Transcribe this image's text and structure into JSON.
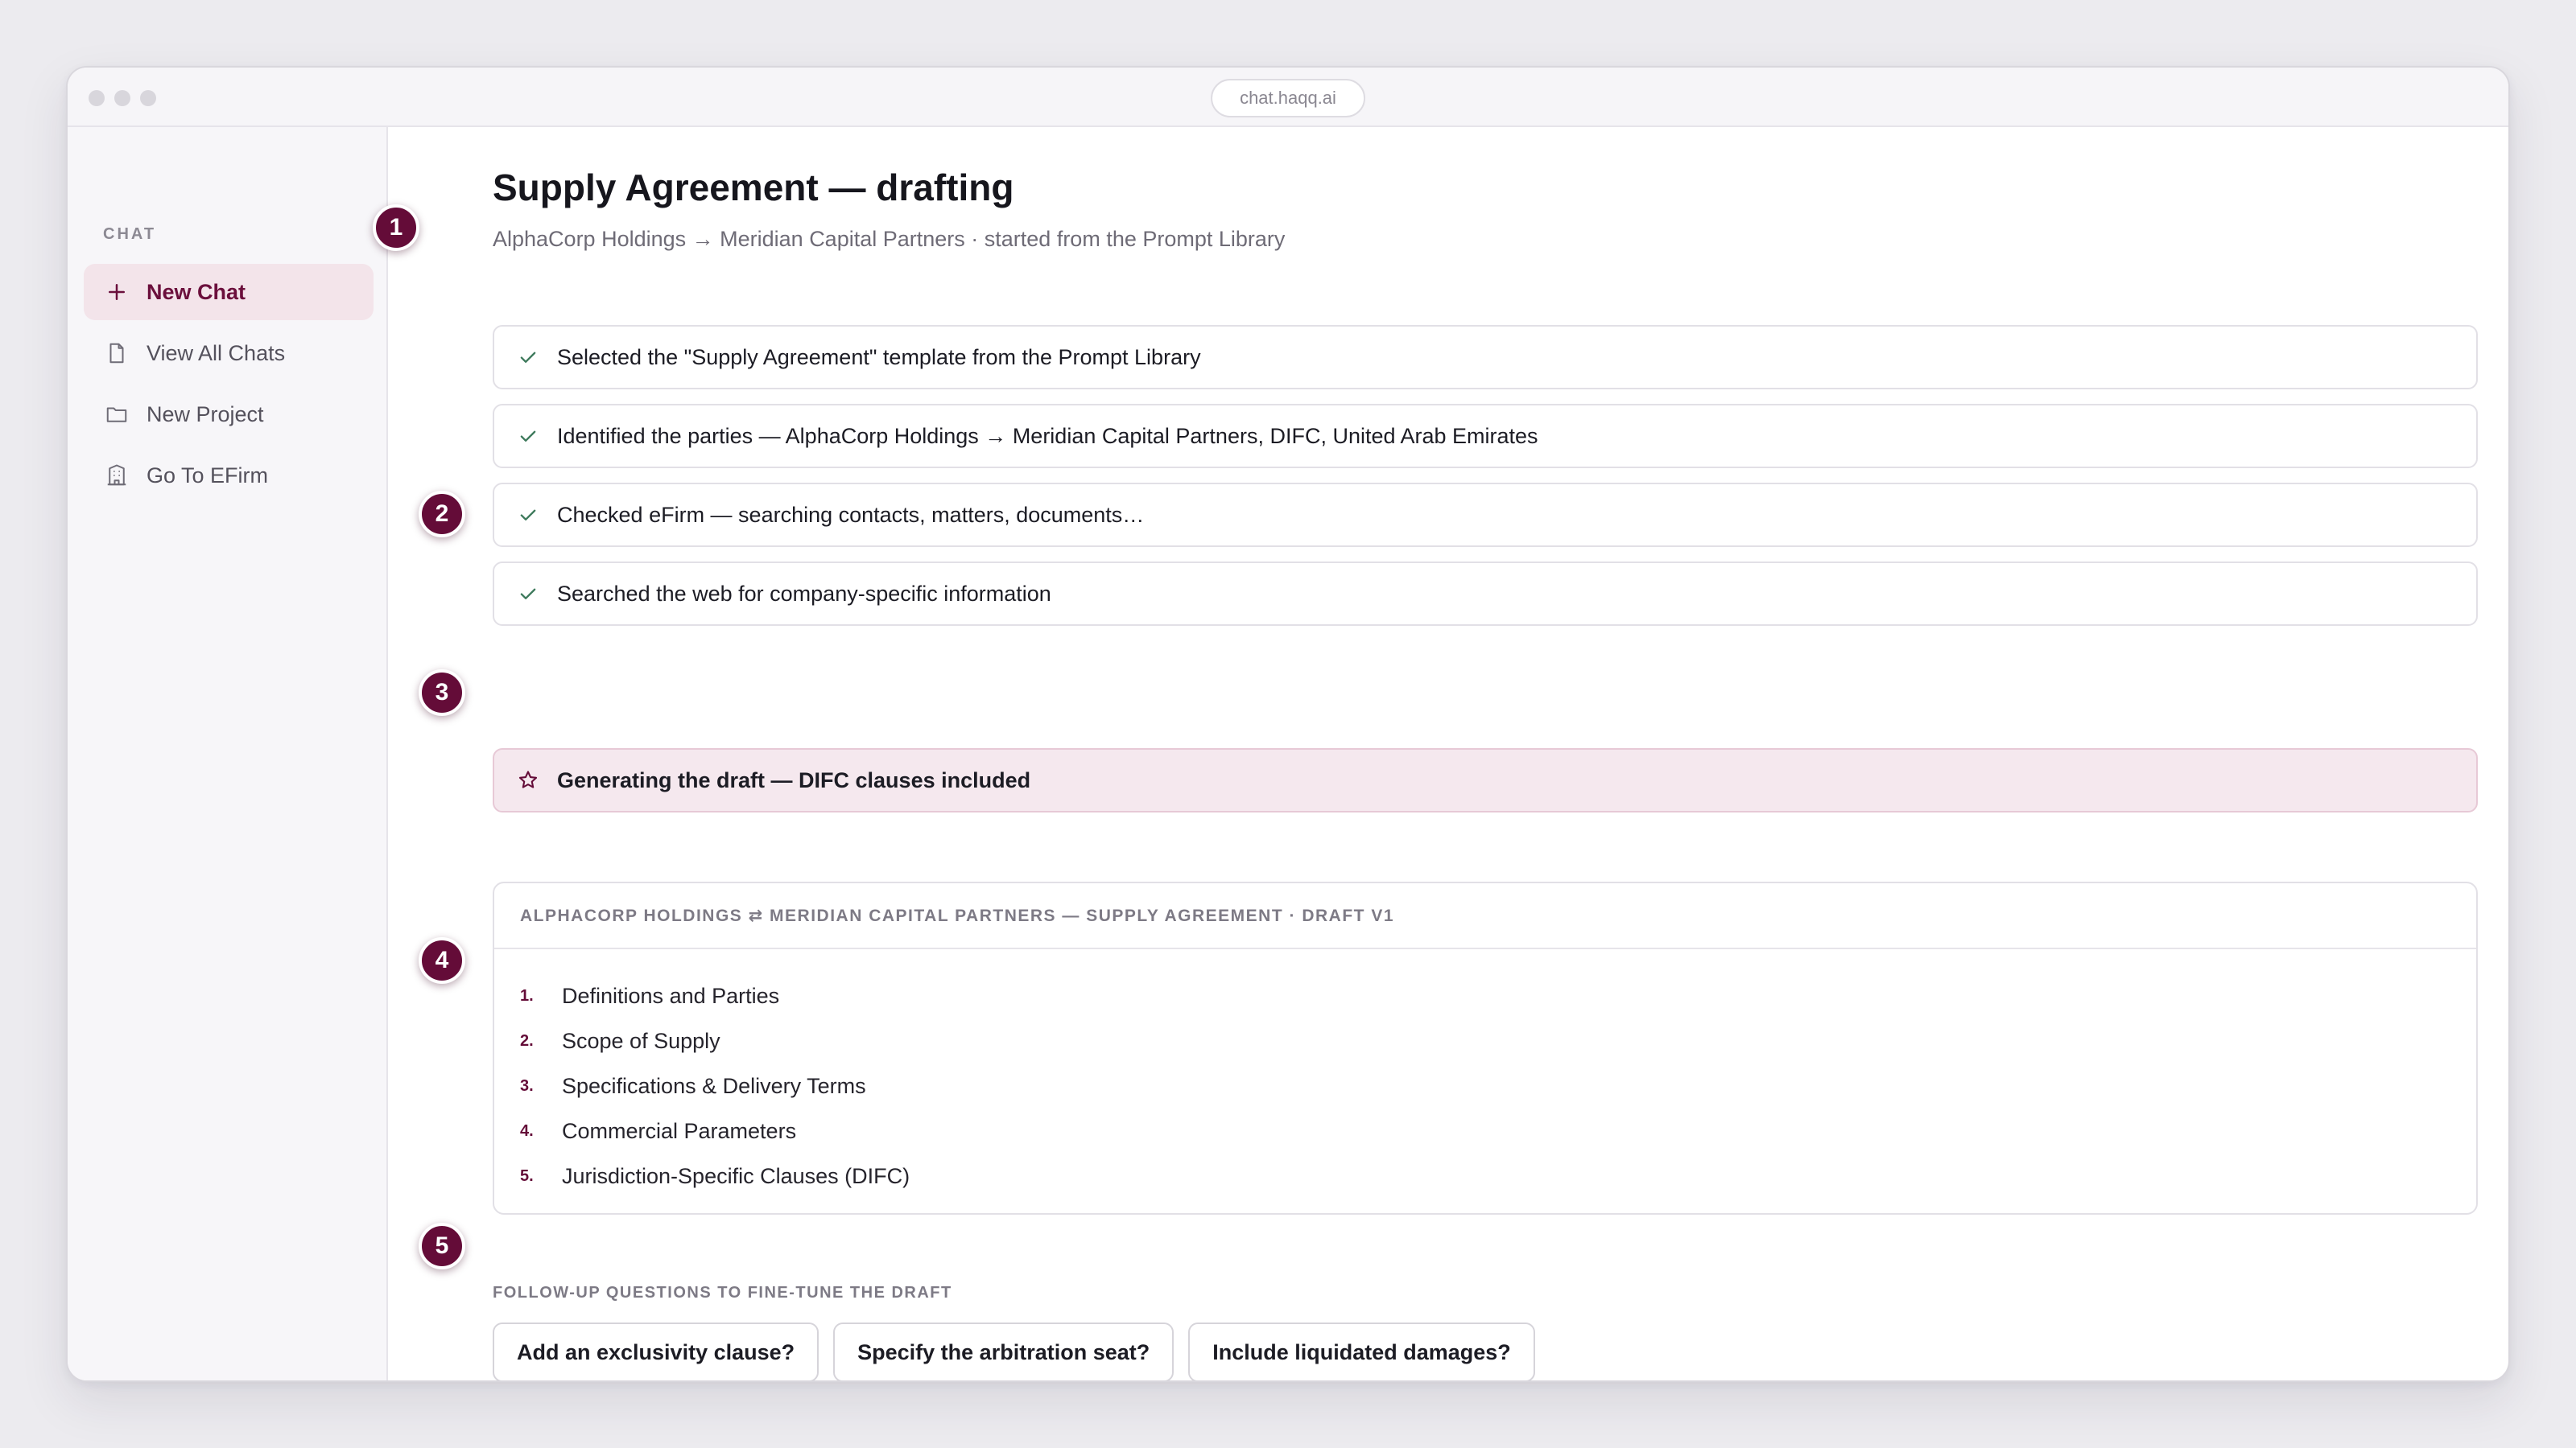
{
  "browser": {
    "url": "chat.haqq.ai"
  },
  "sidebar": {
    "section_label": "CHAT",
    "items": [
      {
        "label": "New Chat",
        "icon": "plus-icon"
      },
      {
        "label": "View All Chats",
        "icon": "document-icon"
      },
      {
        "label": "New Project",
        "icon": "folder-icon"
      },
      {
        "label": "Go To EFirm",
        "icon": "building-icon"
      }
    ]
  },
  "main": {
    "title": "Supply Agreement — drafting",
    "subtitle": "AlphaCorp Holdings → Meridian Capital Partners · started from the Prompt Library",
    "steps": [
      {
        "label": "Selected the \"Supply Agreement\" template from the Prompt Library",
        "status": "done"
      },
      {
        "label": "Identified the parties — AlphaCorp Holdings → Meridian Capital Partners, DIFC, United Arab Emirates",
        "status": "done"
      },
      {
        "label": "Checked eFirm — searching contacts, matters, documents…",
        "status": "done"
      },
      {
        "label": "Searched the web for company-specific information",
        "status": "done"
      },
      {
        "label": "Generating the draft — DIFC clauses included",
        "status": "in-progress"
      }
    ],
    "draft": {
      "header": "ALPHACORP HOLDINGS ⇄ MERIDIAN CAPITAL PARTNERS — SUPPLY AGREEMENT · DRAFT V1",
      "sections": [
        {
          "num": "1.",
          "title": "Definitions and Parties"
        },
        {
          "num": "2.",
          "title": "Scope of Supply"
        },
        {
          "num": "3.",
          "title": "Specifications & Delivery Terms"
        },
        {
          "num": "4.",
          "title": "Commercial Parameters"
        },
        {
          "num": "5.",
          "title": "Jurisdiction-Specific Clauses (DIFC)"
        }
      ]
    },
    "followup": {
      "label": "FOLLOW-UP QUESTIONS TO FINE-TUNE THE DRAFT",
      "chips": [
        "Add an exclusivity clause?",
        "Specify the arbitration seat?",
        "Include liquidated damages?"
      ]
    }
  },
  "callouts": [
    "1",
    "2",
    "3",
    "4",
    "5"
  ],
  "colors": {
    "accent": "#640c38",
    "accent_bg": "#f3e4ea",
    "check": "#3e7a5c"
  }
}
